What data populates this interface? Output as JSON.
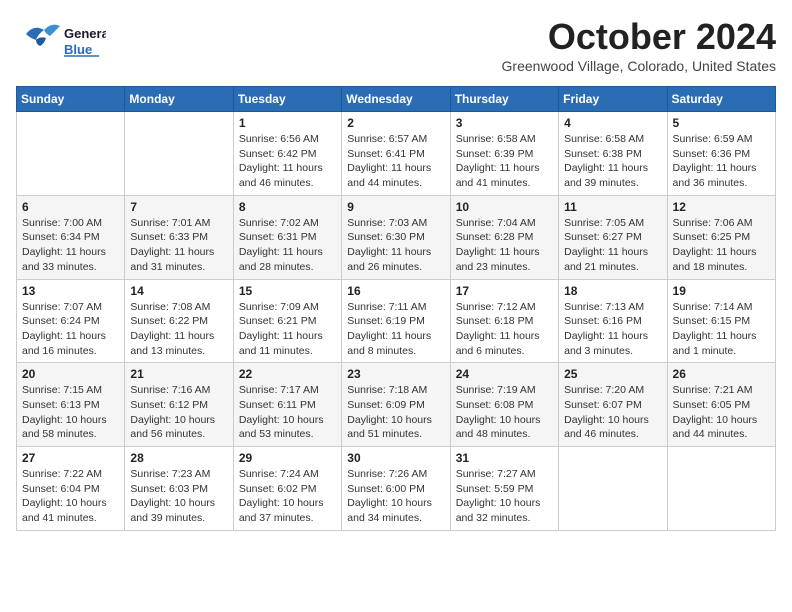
{
  "header": {
    "logo_general": "General",
    "logo_blue": "Blue",
    "month": "October 2024",
    "location": "Greenwood Village, Colorado, United States"
  },
  "weekdays": [
    "Sunday",
    "Monday",
    "Tuesday",
    "Wednesday",
    "Thursday",
    "Friday",
    "Saturday"
  ],
  "weeks": [
    [
      {
        "day": "",
        "info": ""
      },
      {
        "day": "",
        "info": ""
      },
      {
        "day": "1",
        "info": "Sunrise: 6:56 AM\nSunset: 6:42 PM\nDaylight: 11 hours and 46 minutes."
      },
      {
        "day": "2",
        "info": "Sunrise: 6:57 AM\nSunset: 6:41 PM\nDaylight: 11 hours and 44 minutes."
      },
      {
        "day": "3",
        "info": "Sunrise: 6:58 AM\nSunset: 6:39 PM\nDaylight: 11 hours and 41 minutes."
      },
      {
        "day": "4",
        "info": "Sunrise: 6:58 AM\nSunset: 6:38 PM\nDaylight: 11 hours and 39 minutes."
      },
      {
        "day": "5",
        "info": "Sunrise: 6:59 AM\nSunset: 6:36 PM\nDaylight: 11 hours and 36 minutes."
      }
    ],
    [
      {
        "day": "6",
        "info": "Sunrise: 7:00 AM\nSunset: 6:34 PM\nDaylight: 11 hours and 33 minutes."
      },
      {
        "day": "7",
        "info": "Sunrise: 7:01 AM\nSunset: 6:33 PM\nDaylight: 11 hours and 31 minutes."
      },
      {
        "day": "8",
        "info": "Sunrise: 7:02 AM\nSunset: 6:31 PM\nDaylight: 11 hours and 28 minutes."
      },
      {
        "day": "9",
        "info": "Sunrise: 7:03 AM\nSunset: 6:30 PM\nDaylight: 11 hours and 26 minutes."
      },
      {
        "day": "10",
        "info": "Sunrise: 7:04 AM\nSunset: 6:28 PM\nDaylight: 11 hours and 23 minutes."
      },
      {
        "day": "11",
        "info": "Sunrise: 7:05 AM\nSunset: 6:27 PM\nDaylight: 11 hours and 21 minutes."
      },
      {
        "day": "12",
        "info": "Sunrise: 7:06 AM\nSunset: 6:25 PM\nDaylight: 11 hours and 18 minutes."
      }
    ],
    [
      {
        "day": "13",
        "info": "Sunrise: 7:07 AM\nSunset: 6:24 PM\nDaylight: 11 hours and 16 minutes."
      },
      {
        "day": "14",
        "info": "Sunrise: 7:08 AM\nSunset: 6:22 PM\nDaylight: 11 hours and 13 minutes."
      },
      {
        "day": "15",
        "info": "Sunrise: 7:09 AM\nSunset: 6:21 PM\nDaylight: 11 hours and 11 minutes."
      },
      {
        "day": "16",
        "info": "Sunrise: 7:11 AM\nSunset: 6:19 PM\nDaylight: 11 hours and 8 minutes."
      },
      {
        "day": "17",
        "info": "Sunrise: 7:12 AM\nSunset: 6:18 PM\nDaylight: 11 hours and 6 minutes."
      },
      {
        "day": "18",
        "info": "Sunrise: 7:13 AM\nSunset: 6:16 PM\nDaylight: 11 hours and 3 minutes."
      },
      {
        "day": "19",
        "info": "Sunrise: 7:14 AM\nSunset: 6:15 PM\nDaylight: 11 hours and 1 minute."
      }
    ],
    [
      {
        "day": "20",
        "info": "Sunrise: 7:15 AM\nSunset: 6:13 PM\nDaylight: 10 hours and 58 minutes."
      },
      {
        "day": "21",
        "info": "Sunrise: 7:16 AM\nSunset: 6:12 PM\nDaylight: 10 hours and 56 minutes."
      },
      {
        "day": "22",
        "info": "Sunrise: 7:17 AM\nSunset: 6:11 PM\nDaylight: 10 hours and 53 minutes."
      },
      {
        "day": "23",
        "info": "Sunrise: 7:18 AM\nSunset: 6:09 PM\nDaylight: 10 hours and 51 minutes."
      },
      {
        "day": "24",
        "info": "Sunrise: 7:19 AM\nSunset: 6:08 PM\nDaylight: 10 hours and 48 minutes."
      },
      {
        "day": "25",
        "info": "Sunrise: 7:20 AM\nSunset: 6:07 PM\nDaylight: 10 hours and 46 minutes."
      },
      {
        "day": "26",
        "info": "Sunrise: 7:21 AM\nSunset: 6:05 PM\nDaylight: 10 hours and 44 minutes."
      }
    ],
    [
      {
        "day": "27",
        "info": "Sunrise: 7:22 AM\nSunset: 6:04 PM\nDaylight: 10 hours and 41 minutes."
      },
      {
        "day": "28",
        "info": "Sunrise: 7:23 AM\nSunset: 6:03 PM\nDaylight: 10 hours and 39 minutes."
      },
      {
        "day": "29",
        "info": "Sunrise: 7:24 AM\nSunset: 6:02 PM\nDaylight: 10 hours and 37 minutes."
      },
      {
        "day": "30",
        "info": "Sunrise: 7:26 AM\nSunset: 6:00 PM\nDaylight: 10 hours and 34 minutes."
      },
      {
        "day": "31",
        "info": "Sunrise: 7:27 AM\nSunset: 5:59 PM\nDaylight: 10 hours and 32 minutes."
      },
      {
        "day": "",
        "info": ""
      },
      {
        "day": "",
        "info": ""
      }
    ]
  ]
}
